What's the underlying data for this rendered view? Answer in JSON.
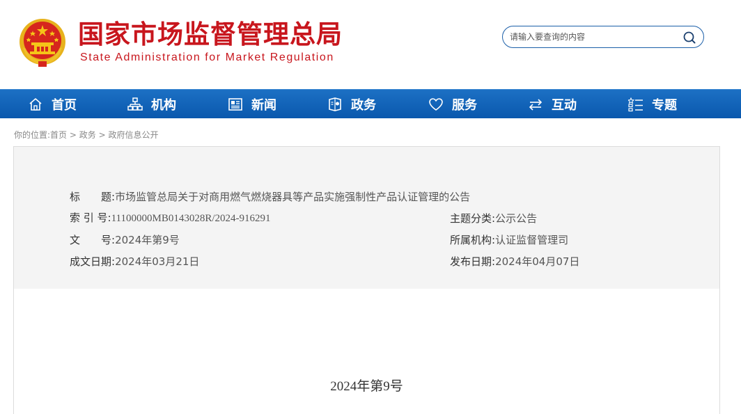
{
  "header": {
    "title_cn": "国家市场监督管理总局",
    "title_en": "State Administration for Market Regulation",
    "emblem_icon": "national-emblem-icon",
    "brand_color": "#c8161d"
  },
  "search": {
    "placeholder": "请输入要查询的内容",
    "icon": "search-icon"
  },
  "nav": {
    "items": [
      {
        "label": "首页",
        "icon": "home-icon"
      },
      {
        "label": "机构",
        "icon": "org-chart-icon"
      },
      {
        "label": "新闻",
        "icon": "newspaper-icon"
      },
      {
        "label": "政务",
        "icon": "government-icon"
      },
      {
        "label": "服务",
        "icon": "heart-icon"
      },
      {
        "label": "互动",
        "icon": "exchange-icon"
      },
      {
        "label": "专题",
        "icon": "topic-list-icon"
      }
    ],
    "color": "#0a5aae"
  },
  "breadcrumb": {
    "prefix": "你的位置:",
    "items": [
      "首页",
      "政务",
      "政府信息公开"
    ],
    "separator": " > "
  },
  "info": {
    "title_label": "标　　题:",
    "title_value": "市场监管总局关于对商用燃气燃烧器具等产品实施强制性产品认证管理的公告",
    "index_label": "索 引 号:",
    "index_value": "11100000MB0143028R/2024-916291",
    "category_label": "主题分类:",
    "category_value": "公示公告",
    "docno_label": "文　　号:",
    "docno_value": "2024年第9号",
    "agency_label": "所属机构:",
    "agency_value": "认证监督管理司",
    "written_label": "成文日期:",
    "written_value": "2024年03月21日",
    "published_label": "发布日期:",
    "published_value": "2024年04月07日"
  },
  "content": {
    "doc_number": "2024年第9号"
  }
}
